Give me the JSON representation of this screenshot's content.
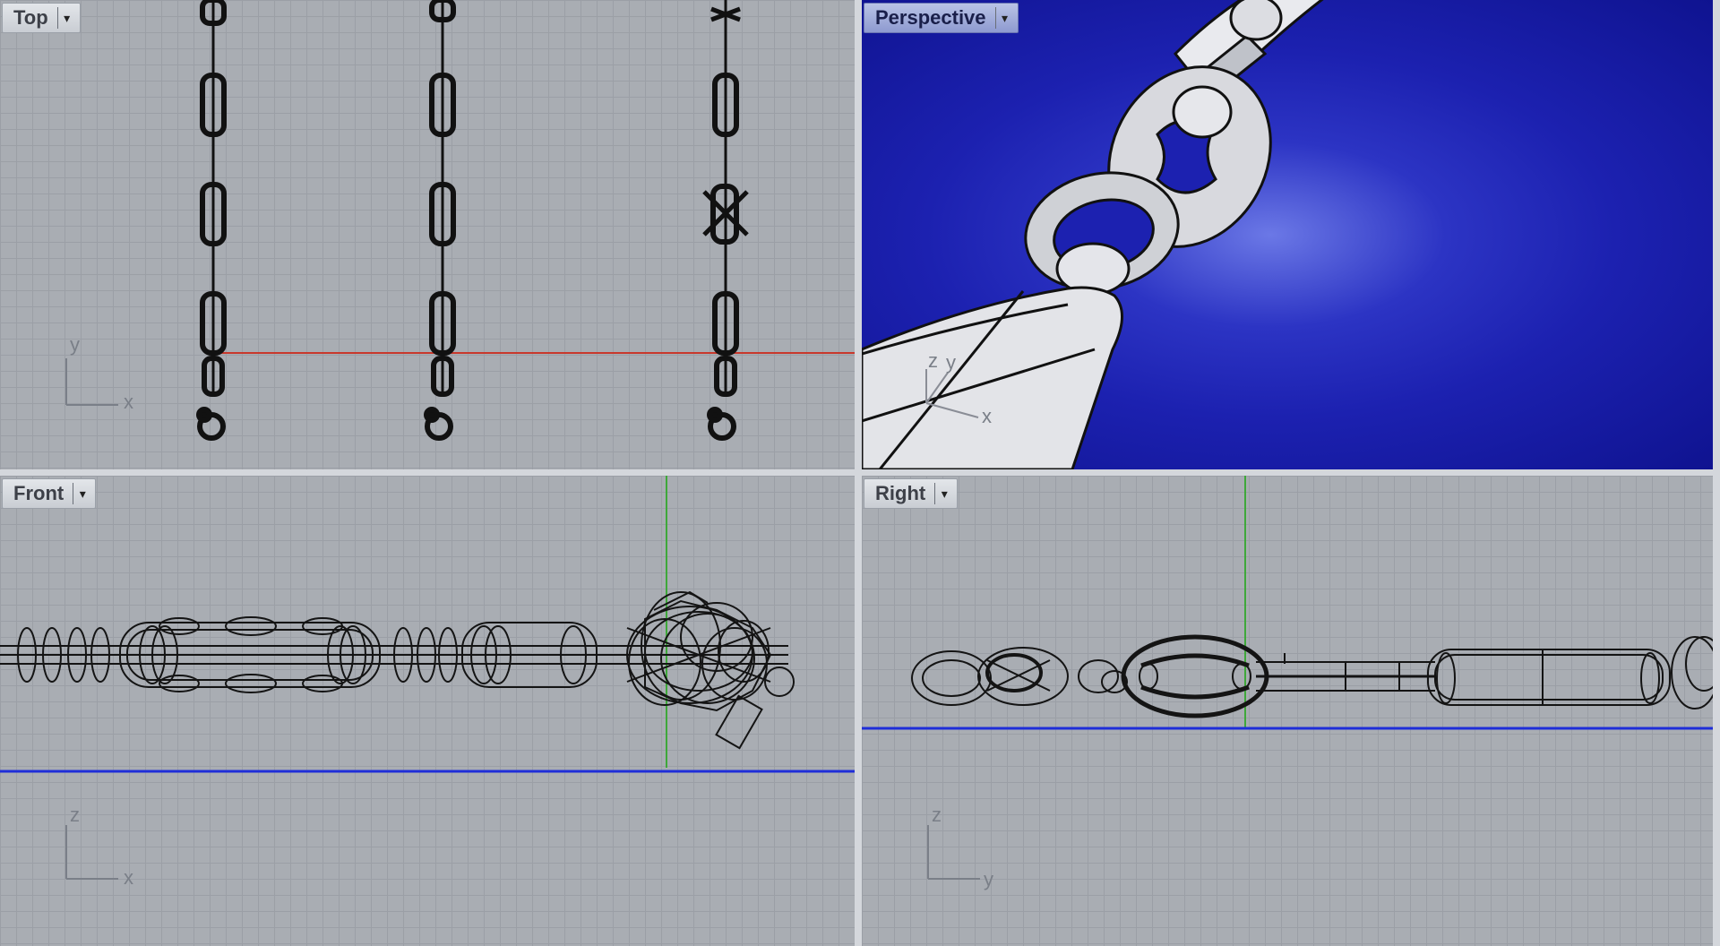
{
  "viewports": {
    "top": {
      "label": "Top"
    },
    "perspective": {
      "label": "Perspective"
    },
    "front": {
      "label": "Front"
    },
    "right": {
      "label": "Right"
    }
  },
  "axes": {
    "top": {
      "a": "y",
      "b": "x"
    },
    "persp": {
      "a": "z",
      "b": "y",
      "c": "x"
    },
    "front": {
      "a": "z",
      "b": "x"
    },
    "right": {
      "a": "z",
      "b": "y"
    }
  },
  "icons": {
    "viewport_menu": "dropdown-arrow-icon"
  },
  "colors": {
    "x_axis": "#c8382c",
    "y_axis": "#3ea83a",
    "z_axis": "#1f2ed8",
    "ortho_bg": "#a9adb3",
    "persp_bg": "#1c21b0",
    "wire": "#141414"
  }
}
